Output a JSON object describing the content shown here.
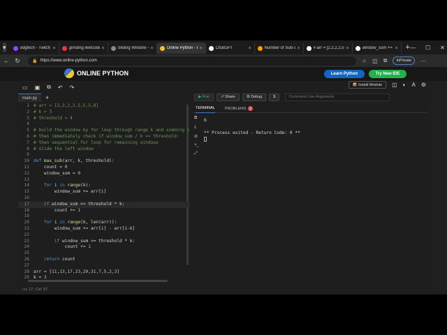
{
  "browser": {
    "tabs": [
      {
        "label": "edgtech - Twitch",
        "color": "#9146ff",
        "active": false
      },
      {
        "label": "grinding leetcode |",
        "color": "#e53935",
        "active": false
      },
      {
        "label": "Sliding Window - L",
        "color": "#888888",
        "active": false
      },
      {
        "label": "Online Python - IDE",
        "color": "#f1c232",
        "active": true
      },
      {
        "label": "ChatGPT",
        "color": "#ffffff",
        "active": false
      },
      {
        "label": "Number of Sub-arr",
        "color": "#ffa000",
        "active": false
      },
      {
        "label": "# arr = [2,2,2,2,5,5,",
        "color": "#ffffff",
        "active": false
      },
      {
        "label": "window_sum += ar",
        "color": "#ffffff",
        "active": false
      }
    ],
    "new_tab_label": "+",
    "url": "https://www.online-python.com",
    "inprivate_label": "InPrivate"
  },
  "site": {
    "logo_text": "ONLINE PYTHON",
    "learn_button": "Learn Python",
    "try_button": "Try New IDE"
  },
  "editor": {
    "file_tab": "main.py",
    "add_tab": "+",
    "status": "Ln: 17, Col: 27",
    "lines": [
      {
        "n": "1",
        "code": "# arr = [2,2,2,2,5,5,5,8]",
        "cls": "cm"
      },
      {
        "n": "2",
        "code": "# k = 3",
        "cls": "cm"
      },
      {
        "n": "3",
        "code": "# threshold = 4",
        "cls": "cm"
      },
      {
        "n": "4",
        "code": "",
        "cls": ""
      },
      {
        "n": "5",
        "code": "# build the window by for loop through range k and summing it",
        "cls": "cm"
      },
      {
        "n": "6",
        "code": "# then immediately check if window_sum / k >= threshold:",
        "cls": "cm"
      },
      {
        "n": "7",
        "code": "# then sequential for loop for remaining windows",
        "cls": "cm"
      },
      {
        "n": "8",
        "code": "# slide the left window",
        "cls": "cm"
      },
      {
        "n": "9",
        "code": "",
        "cls": ""
      },
      {
        "n": "10",
        "code": "def max_sub(arr, k, threshold):",
        "cls": "def"
      },
      {
        "n": "11",
        "code": "    count = 0",
        "cls": ""
      },
      {
        "n": "12",
        "code": "    window_sum = 0",
        "cls": ""
      },
      {
        "n": "13",
        "code": "",
        "cls": ""
      },
      {
        "n": "14",
        "code": "    for i in range(k):",
        "cls": "kwline"
      },
      {
        "n": "15",
        "code": "        window_sum += arr[i]",
        "cls": ""
      },
      {
        "n": "16",
        "code": "",
        "cls": ""
      },
      {
        "n": "17",
        "code": "    if window_sum >= threshold * k:",
        "cls": "kwline hl"
      },
      {
        "n": "18",
        "code": "        count += 1",
        "cls": ""
      },
      {
        "n": "19",
        "code": "",
        "cls": ""
      },
      {
        "n": "20",
        "code": "    for i in range(k, len(arr)):",
        "cls": "kwline"
      },
      {
        "n": "21",
        "code": "        window_sum += arr[i] - arr[i-k]",
        "cls": ""
      },
      {
        "n": "22",
        "code": "",
        "cls": ""
      },
      {
        "n": "23",
        "code": "        if window_sum >= threshold * k:",
        "cls": "kwline"
      },
      {
        "n": "24",
        "code": "            count += 1",
        "cls": ""
      },
      {
        "n": "25",
        "code": "",
        "cls": ""
      },
      {
        "n": "26",
        "code": "    return count",
        "cls": "kwline"
      },
      {
        "n": "27",
        "code": "",
        "cls": ""
      },
      {
        "n": "28",
        "code": "arr = [11,13,17,23,29,31,7,5,2,3]",
        "cls": ""
      },
      {
        "n": "29",
        "code": "k = 3",
        "cls": ""
      }
    ]
  },
  "run_panel": {
    "run": "Run",
    "share": "Share",
    "debug": "Debug",
    "dollar": "$",
    "cmd_placeholder": "Command Line Arguments",
    "install": "Install Module",
    "terminal_tab": "TERMINAL",
    "problems_tab": "PROBLEMS",
    "problems_count": "2",
    "output": [
      "6",
      "",
      "** Process exited - Return Code: 0 **"
    ]
  }
}
